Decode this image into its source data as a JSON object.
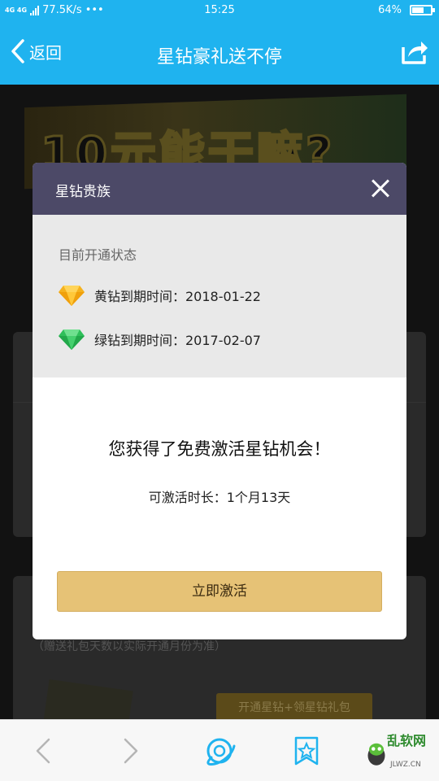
{
  "status_bar": {
    "network": "4G 4G",
    "speed": "77.5K/s",
    "dots": "•••",
    "time": "15:25",
    "battery_text": "64%",
    "battery_level": 0.64
  },
  "header": {
    "back_label": "返回",
    "title": "星钻豪礼送不停"
  },
  "background": {
    "banner_text": "10元能干嘛?",
    "note": "（赠送礼包天数以实际开通月份为准）",
    "button_label": "开通星钻+领星钻礼包"
  },
  "modal": {
    "title": "星钻贵族",
    "status_heading": "目前开通状态",
    "yellow_label": "黄钻到期时间：2018-01-22",
    "green_label": "绿钻到期时间：2017-02-07",
    "promo_text": "您获得了免费激活星钻机会！",
    "duration_text": "可激活时长：1个月13天",
    "activate_label": "立即激活",
    "colors": {
      "header": "#4c4967",
      "button": "#e6c276",
      "yellow_gem": "#f5b21e",
      "green_gem": "#2fbf5a"
    }
  },
  "watermark": {
    "text": "乱软网",
    "sub": "JLWZ.CN"
  }
}
